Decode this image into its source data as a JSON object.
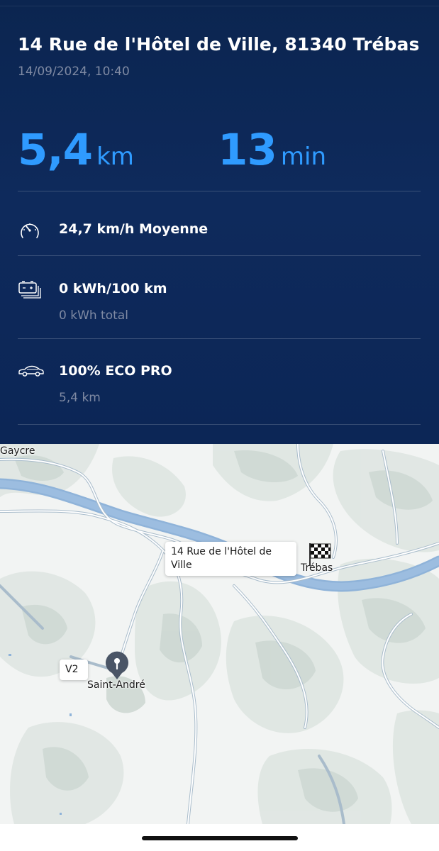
{
  "trip": {
    "address": "14 Rue de l'Hôtel de Ville, 81340 Trébas",
    "datetime": "14/09/2024, 10:40"
  },
  "summary": {
    "distance_value": "5,4",
    "distance_unit": "km",
    "duration_value": "13",
    "duration_unit": "min"
  },
  "stats": [
    {
      "icon": "speedometer-icon",
      "title": "24,7 km/h Moyenne",
      "subtitle": ""
    },
    {
      "icon": "battery-icon",
      "title": "0 kWh/100 km",
      "subtitle": "0 kWh total"
    },
    {
      "icon": "car-icon",
      "title": "100% ECO PRO",
      "subtitle": "5,4 km"
    }
  ],
  "map": {
    "places": {
      "gaycre": "Gaycre",
      "trebas": "Trébas",
      "saint_andre": "Saint-André"
    },
    "destination_callout": "14 Rue de l'Hôtel de Ville",
    "start_callout": "V2",
    "start_marker_icon": "pin-icon",
    "destination_marker_icon": "checkered-flag-icon"
  },
  "colors": {
    "panel_background": "#0e2a5c",
    "accent_blue": "#2f9bff",
    "secondary_text": "#7f8aa3",
    "river": "#8fb3d9"
  }
}
